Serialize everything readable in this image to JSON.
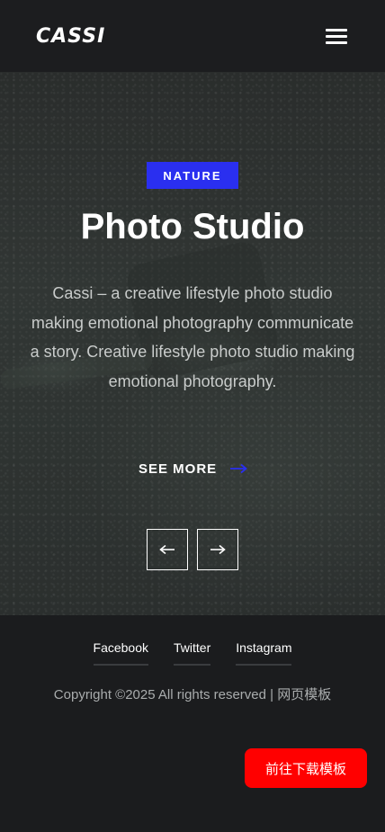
{
  "header": {
    "logo_text": "CASSI",
    "menu_icon": "hamburger-menu-icon"
  },
  "hero": {
    "badge": "NATURE",
    "title": "Photo Studio",
    "description": "Cassi – a creative lifestyle photo studio making emotional photography communicate a story. Creative lifestyle photo studio making emotional photography.",
    "see_more_label": "SEE MORE",
    "see_more_icon": "arrow-right-icon",
    "prev_icon": "arrow-left-icon",
    "next_icon": "arrow-right-icon",
    "accent_color": "#2a2ff0"
  },
  "footer": {
    "social_links": [
      "Facebook",
      "Twitter",
      "Instagram"
    ],
    "copyright": "Copyright ©2025 All rights reserved | 网页模板",
    "download_button": "前往下载模板",
    "download_color": "#ff0000"
  }
}
